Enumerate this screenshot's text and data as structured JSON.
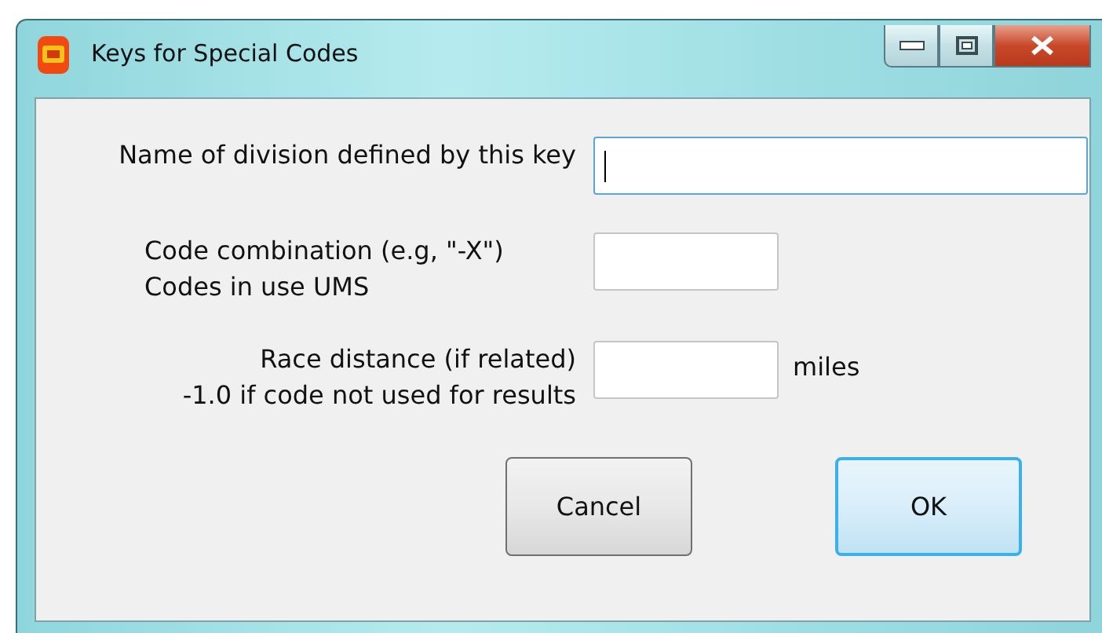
{
  "window": {
    "title": "Keys for Special Codes"
  },
  "fields": [
    {
      "label_lines": [
        "Name of division defined by this key"
      ],
      "focused": true
    },
    {
      "label_lines": [
        "Code combination (e.g, \"-X\")",
        "Codes in use UMS"
      ],
      "focused": false
    },
    {
      "label_lines": [
        "Race distance (if related)",
        "-1.0 if code not used for results"
      ],
      "focused": false,
      "unit": "miles"
    }
  ],
  "buttons": [
    {
      "label": "Cancel",
      "default": false
    },
    {
      "label": "OK",
      "default": true
    }
  ]
}
